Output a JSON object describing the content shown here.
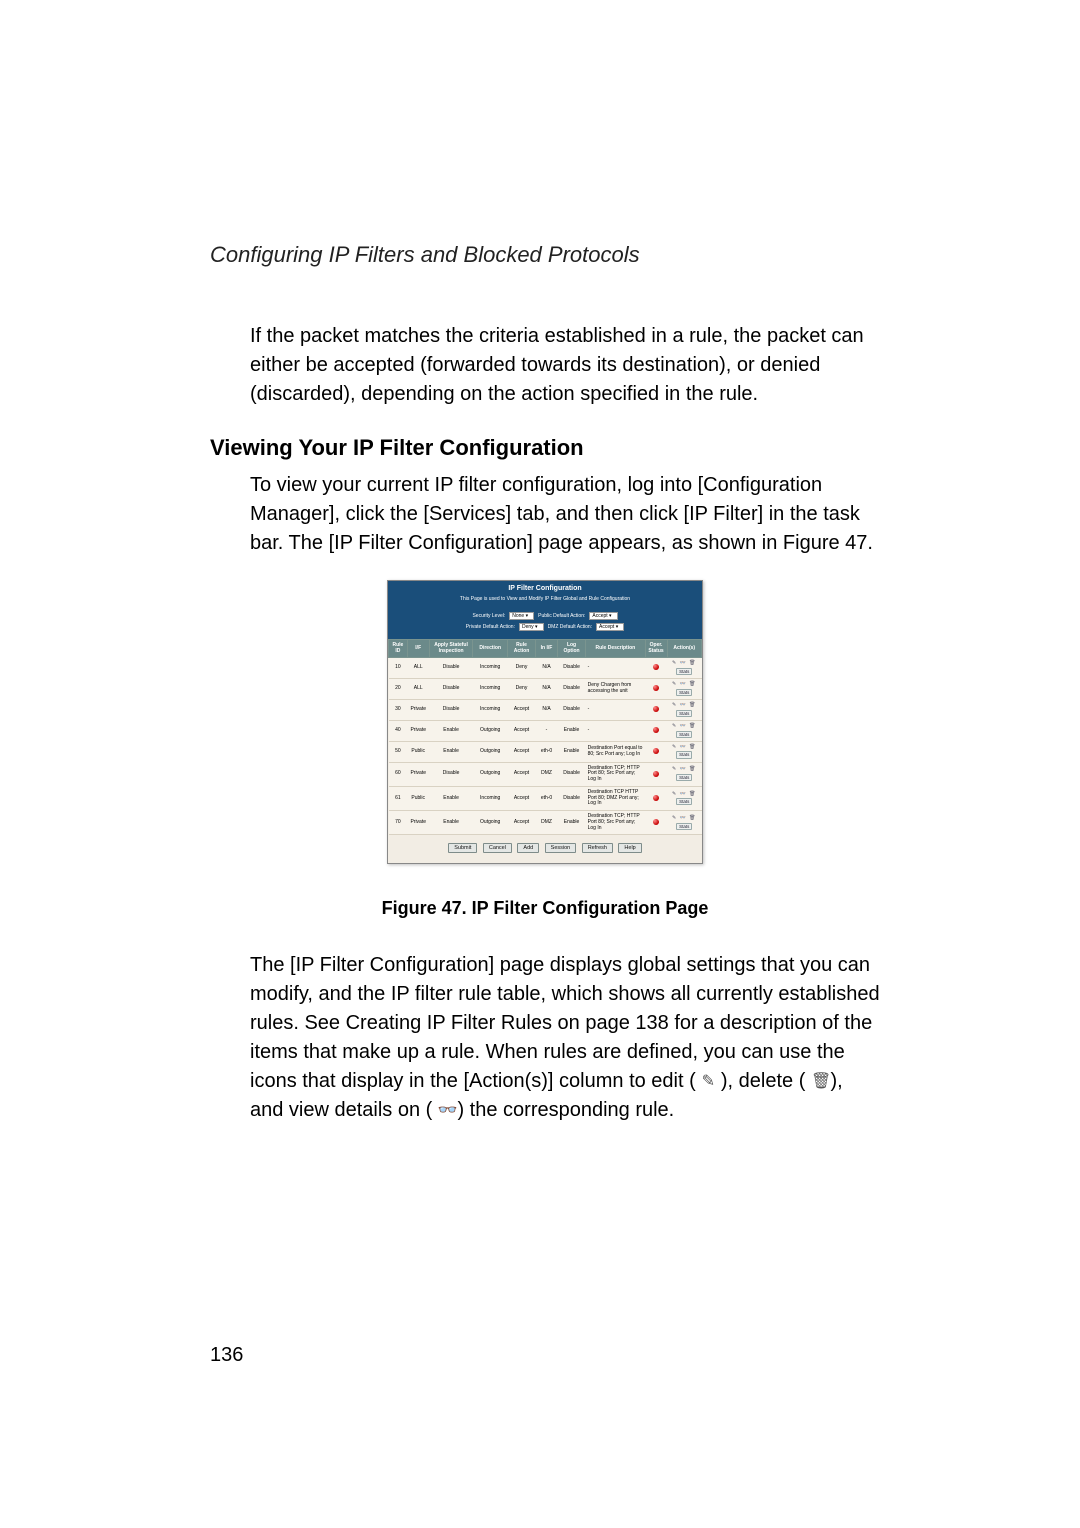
{
  "header": {
    "running_title": "Configuring IP Filters and Blocked Protocols"
  },
  "body": {
    "intro": "If the packet matches the criteria established in a rule, the packet can either be accepted (forwarded towards its destination), or denied (discarded), depending on the action specified in the rule.",
    "section_title": "Viewing Your IP Filter Configuration",
    "viewing_para": "To view your current IP filter configuration, log into [Configuration Manager], click the [Services] tab, and then click [IP Filter] in the task bar. The [IP Filter Configuration] page appears, as shown in Figure 47.",
    "desc": {
      "p1": "The [IP Filter Configuration] page displays global settings that you can modify, and the IP filter rule table, which shows all currently established rules. See Creating IP Filter Rules on page 138 for a description of the items that make up a rule. ",
      "p2": "When rules are defined, you can use the icons that display in the [Action(s)] column to edit (",
      "p3": "), delete (",
      "p4": "), and view details on (",
      "p5": ") the corresponding rule."
    }
  },
  "icons": {
    "edit": "✎",
    "delete": "🗑",
    "view": "👓"
  },
  "figure": {
    "window_title": "IP Filter Configuration",
    "subtitle": "This Page is used to View and Modify IP Filter Global and Rule Configuration",
    "ctrl": {
      "security_label": "Security Level:",
      "security_value": "None ▾",
      "public_label": "Public Default Action:",
      "public_value": "Accept ▾",
      "private_label": "Private Default Action:",
      "private_value": "Deny ▾",
      "dmz_label": "DMZ Default Action:",
      "dmz_value": "Accept ▾"
    },
    "table": {
      "headers": [
        "Rule ID",
        "I/F",
        "Apply Stateful Inspection",
        "Direction",
        "Rule Action",
        "In I/F",
        "Log Option",
        "Rule Description",
        "Oper. Status",
        "Action(s)"
      ],
      "rows": [
        {
          "id": "10",
          "if": "ALL",
          "apply": "Disable",
          "dir": "Incoming",
          "act": "Deny",
          "inif": "N/A",
          "log": "Disable",
          "desc": "-",
          "status": "red"
        },
        {
          "id": "20",
          "if": "ALL",
          "apply": "Disable",
          "dir": "Incoming",
          "act": "Deny",
          "inif": "N/A",
          "log": "Disable",
          "desc": "Deny Chargen from accessing the unit",
          "status": "red"
        },
        {
          "id": "30",
          "if": "Private",
          "apply": "Disable",
          "dir": "Incoming",
          "act": "Accept",
          "inif": "N/A",
          "log": "Disable",
          "desc": "-",
          "status": "red"
        },
        {
          "id": "40",
          "if": "Private",
          "apply": "Enable",
          "dir": "Outgoing",
          "act": "Accept",
          "inif": "-",
          "log": "Enable",
          "desc": "-",
          "status": "red"
        },
        {
          "id": "50",
          "if": "Public",
          "apply": "Enable",
          "dir": "Outgoing",
          "act": "Accept",
          "inif": "eth-0",
          "log": "Enable",
          "desc": "Destination Port equal to 80; Src Port any; Log In",
          "status": "red"
        },
        {
          "id": "60",
          "if": "Private",
          "apply": "Disable",
          "dir": "Outgoing",
          "act": "Accept",
          "inif": "DMZ",
          "log": "Disable",
          "desc": "Destination TCP; HTTP Port 80; Src Port any; Log In",
          "status": "red"
        },
        {
          "id": "61",
          "if": "Public",
          "apply": "Enable",
          "dir": "Incoming",
          "act": "Accept",
          "inif": "eth-0",
          "log": "Disable",
          "desc": "Destination TCP HTTP Port 80; DMZ Port any; Log In",
          "status": "red"
        },
        {
          "id": "70",
          "if": "Private",
          "apply": "Enable",
          "dir": "Outgoing",
          "act": "Accept",
          "inif": "DMZ",
          "log": "Enable",
          "desc": "Destination TCP; HTTP Port 80; Src Port any; Log In",
          "status": "red"
        }
      ],
      "stats_label": "Stats"
    },
    "buttons": [
      "Submit",
      "Cancel",
      "Add",
      "Session",
      "Refresh",
      "Help"
    ],
    "caption": "Figure 47.  IP Filter Configuration Page"
  },
  "page_number": "136"
}
